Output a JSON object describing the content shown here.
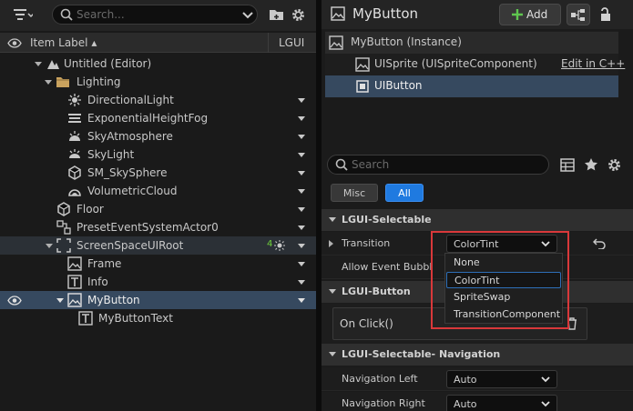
{
  "outliner": {
    "search_placeholder": "Search...",
    "column_item_label": "Item Label ▴",
    "column_lgui": "LGUI",
    "rows": [
      {
        "label": "Untitled (Editor)"
      },
      {
        "label": "Lighting"
      },
      {
        "label": "DirectionalLight"
      },
      {
        "label": "ExponentialHeightFog"
      },
      {
        "label": "SkyAtmosphere"
      },
      {
        "label": "SkyLight"
      },
      {
        "label": "SM_SkySphere"
      },
      {
        "label": "VolumetricCloud"
      },
      {
        "label": "Floor"
      },
      {
        "label": "PresetEventSystemActor0"
      },
      {
        "label": "ScreenSpaceUIRoot",
        "badge": "4"
      },
      {
        "label": "Frame"
      },
      {
        "label": "Info"
      },
      {
        "label": "MyButton"
      },
      {
        "label": "MyButtonText"
      }
    ]
  },
  "details": {
    "title": "MyButton",
    "add_label": "Add",
    "components": {
      "instance": "MyButton (Instance)",
      "sprite": "UISprite (UISpriteComponent)",
      "edit_link": "Edit in C++",
      "button": "UIButton"
    },
    "search_placeholder": "Search",
    "tabs": {
      "misc": "Misc",
      "all": "All"
    },
    "sections": {
      "selectable": "LGUI-Selectable",
      "button": "LGUI-Button",
      "navigation": "LGUI-Selectable- Navigation"
    },
    "props": {
      "transition_label": "Transition",
      "transition_value": "ColorTint",
      "allow_event_label": "Allow Event Bubbl...",
      "on_click": "On Click()",
      "nav_left_label": "Navigation Left",
      "nav_left_value": "Auto",
      "nav_right_label": "Navigation Right",
      "nav_right_value": "Auto"
    },
    "dropdown_options": [
      "None",
      "ColorTint",
      "SpriteSwap",
      "TransitionComponent"
    ]
  },
  "colors": {
    "accent": "#1f7ae0",
    "selection": "#36495f",
    "highlight_box": "#d9383a"
  }
}
